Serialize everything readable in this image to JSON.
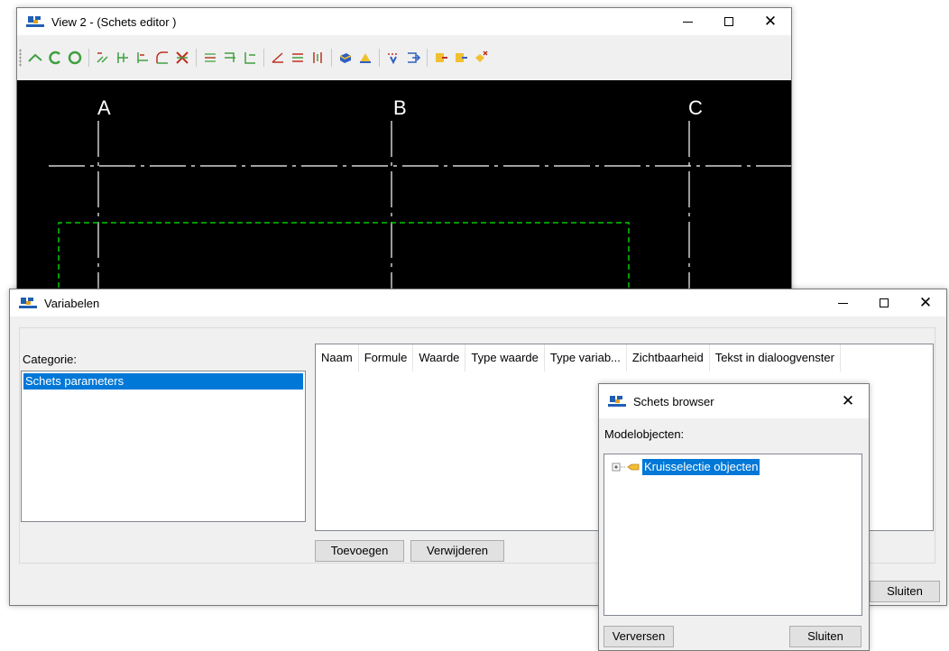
{
  "sketch_window": {
    "title": "View 2 - (Schets editor )",
    "grid_labels": [
      "A",
      "B",
      "C"
    ]
  },
  "variables_window": {
    "title": "Variabelen",
    "category_label": "Categorie:",
    "categories": [
      "Schets parameters"
    ],
    "columns": [
      "Naam",
      "Formule",
      "Waarde",
      "Type waarde",
      "Type variab...",
      "Zichtbaarheid",
      "Tekst in dialoogvenster"
    ],
    "add_button": "Toevoegen",
    "remove_button": "Verwijderen",
    "close_button": "Sluiten"
  },
  "browser_window": {
    "title": "Schets browser",
    "model_objects_label": "Modelobjecten:",
    "tree_items": [
      "Kruisselectie objecten"
    ],
    "refresh_button": "Verversen",
    "close_button": "Sluiten"
  },
  "colors": {
    "selection": "#0078d7",
    "canvas": "#000000",
    "grid_line": "#ffffff",
    "outline": "#00c800"
  }
}
